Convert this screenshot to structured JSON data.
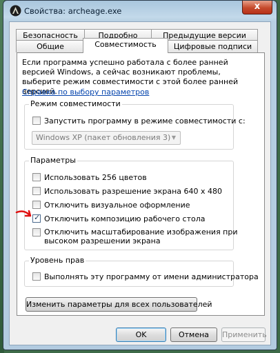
{
  "window": {
    "title": "Свойства: archeage.exe",
    "close_glyph": "x"
  },
  "tabs": {
    "row1": [
      "Безопасность",
      "Подробно",
      "Предыдущие версии"
    ],
    "row2": [
      "Общие",
      "Совместимость",
      "Цифровые подписи"
    ],
    "active": "Совместимость"
  },
  "intro": {
    "text": "Если программа успешно работала с более ранней версией Windows, а сейчас возникают проблемы, выберите режим совместимости с этой более ранней версией.",
    "help_link": "Справка по выбору параметров"
  },
  "compat_mode": {
    "group_label": "Режим совместимости",
    "checkbox_label": "Запустить программу в режиме совместимости с:",
    "checked": false,
    "select_value": "Windows XP (пакет обновления 3)"
  },
  "settings": {
    "group_label": "Параметры",
    "options": [
      {
        "label": "Использовать 256 цветов",
        "checked": false
      },
      {
        "label": "Использовать разрешение экрана 640 x 480",
        "checked": false
      },
      {
        "label": "Отключить визуальное оформление",
        "checked": false
      },
      {
        "label": "Отключить композицию рабочего стола",
        "checked": true
      },
      {
        "label_line1": "Отключить масштабирование изображения при",
        "label_line2": "высоком разрешении экрана",
        "checked": false
      }
    ]
  },
  "privilege": {
    "group_label": "Уровень прав",
    "checkbox_label": "Выполнять эту программу от имени администратора",
    "checked": false
  },
  "all_users_button": "Изменить параметры для всех пользователей",
  "buttons": {
    "ok": "OK",
    "cancel": "Отмена",
    "apply": "Применить"
  },
  "colors": {
    "annotation_arrow": "#e01010",
    "link": "#0645ad"
  }
}
